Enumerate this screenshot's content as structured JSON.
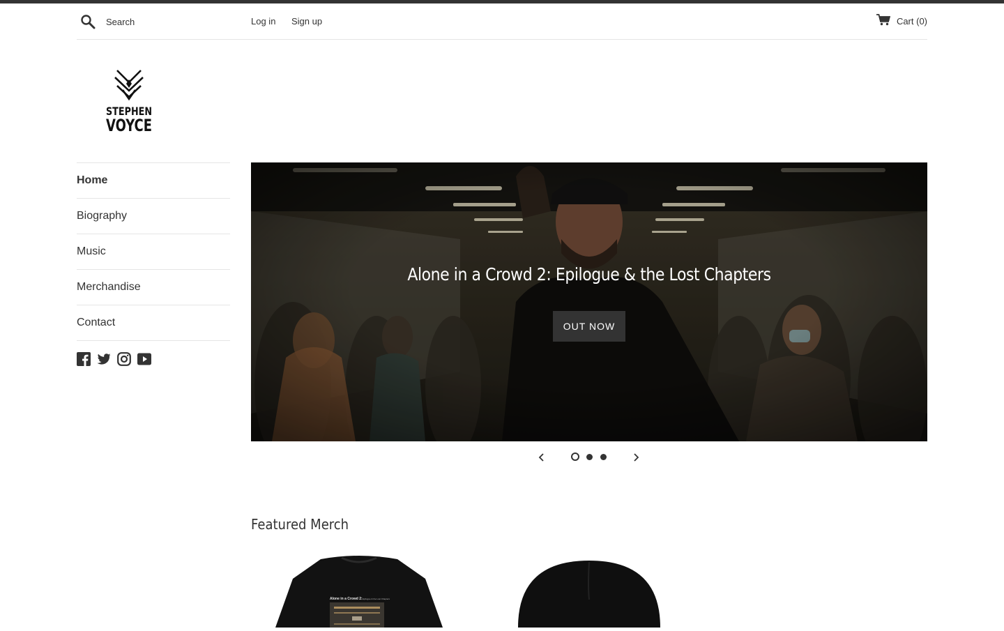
{
  "header": {
    "search_placeholder": "Search",
    "login_label": "Log in",
    "signup_label": "Sign up",
    "cart_label": "Cart (0)"
  },
  "logo": {
    "line1": "STEPHEN",
    "line2": "VOYCE"
  },
  "nav": {
    "items": [
      {
        "label": "Home"
      },
      {
        "label": "Biography"
      },
      {
        "label": "Music"
      },
      {
        "label": "Merchandise"
      },
      {
        "label": "Contact"
      }
    ],
    "active": "Home"
  },
  "social": [
    "facebook-icon",
    "twitter-icon",
    "instagram-icon",
    "youtube-icon"
  ],
  "hero": {
    "title": "Alone in a Crowd 2: Epilogue & the Lost Chapters",
    "button_label": "OUT NOW",
    "slides_total": 3,
    "active_slide": 1
  },
  "featured": {
    "heading": "Featured Merch",
    "shirt_title": "Alone in a Crowd 2:",
    "shirt_subtitle": "Epilogue & the Lost Chapters"
  },
  "colors": {
    "accent": "#333333",
    "border": "#e5e5e5"
  }
}
